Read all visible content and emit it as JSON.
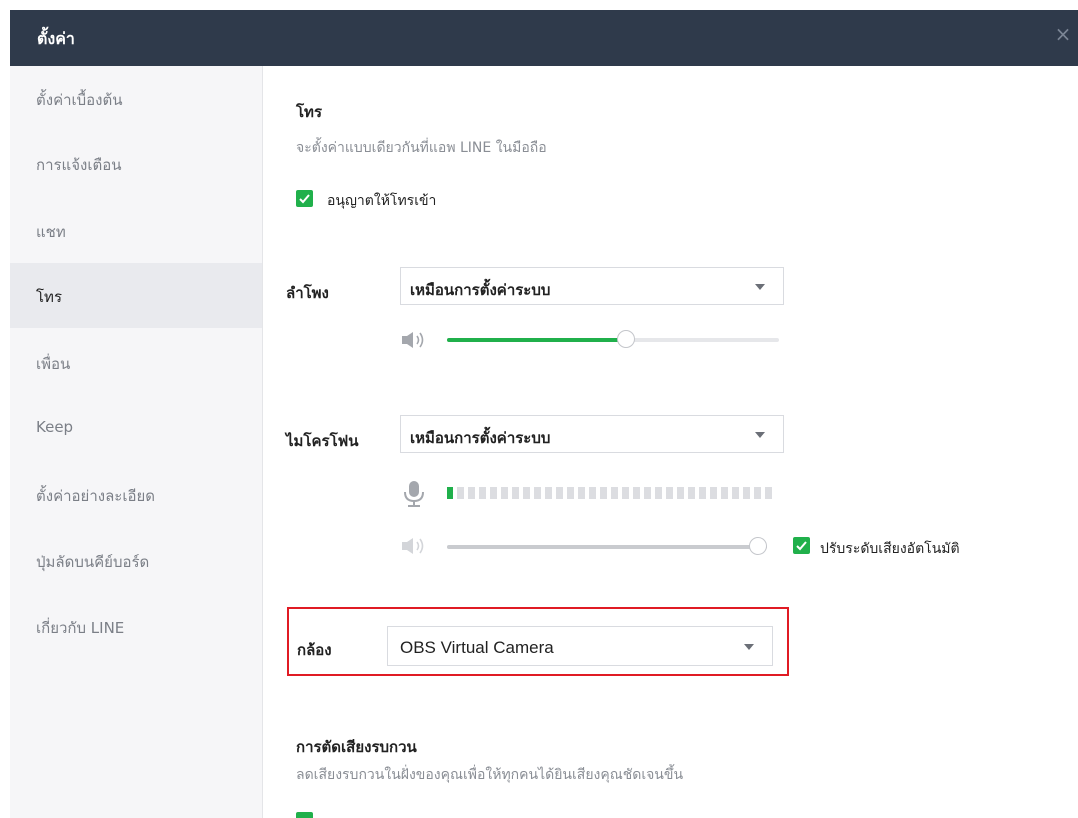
{
  "window": {
    "title": "ตั้งค่า",
    "close_symbol": "×"
  },
  "sidebar": {
    "items": [
      {
        "label": "ตั้งค่าเบื้องต้น"
      },
      {
        "label": "การแจ้งเตือน"
      },
      {
        "label": "แชท"
      },
      {
        "label": "โทร",
        "active": true
      },
      {
        "label": "เพื่อน"
      },
      {
        "label": "Keep"
      },
      {
        "label": "ตั้งค่าอย่างละเอียด"
      },
      {
        "label": "ปุ่มลัดบนคีย์บอร์ด"
      },
      {
        "label": "เกี่ยวกับ LINE"
      }
    ]
  },
  "calls": {
    "title": "โทร",
    "description": "จะตั้งค่าแบบเดียวกันที่แอพ LINE ในมือถือ",
    "allow_incoming_label": "อนุญาตให้โทรเข้า",
    "allow_incoming_checked": true
  },
  "speaker": {
    "label": "ลำโพง",
    "selected": "เหมือนการตั้งค่าระบบ",
    "volume_percent": 54,
    "icon": "speaker-icon"
  },
  "microphone": {
    "label": "ไมโครโฟน",
    "selected": "เหมือนการตั้งค่าระบบ",
    "input_level_segments_on": 1,
    "input_level_segments_total": 30,
    "volume_percent": 100,
    "auto_adjust_label": "ปรับระดับเสียงอัตโนมัติ",
    "auto_adjust_checked": true
  },
  "camera": {
    "label": "กล้อง",
    "selected": "OBS Virtual Camera"
  },
  "noise_suppression": {
    "title": "การตัดเสียงรบกวน",
    "description": "ลดเสียงรบกวนในฝั่งของคุณเพื่อให้ทุกคนได้ยินเสียงคุณชัดเจนขึ้น"
  },
  "colors": {
    "titlebar": "#2f3a4b",
    "accent_green": "#20b04b",
    "highlight_red": "#e01b24"
  }
}
